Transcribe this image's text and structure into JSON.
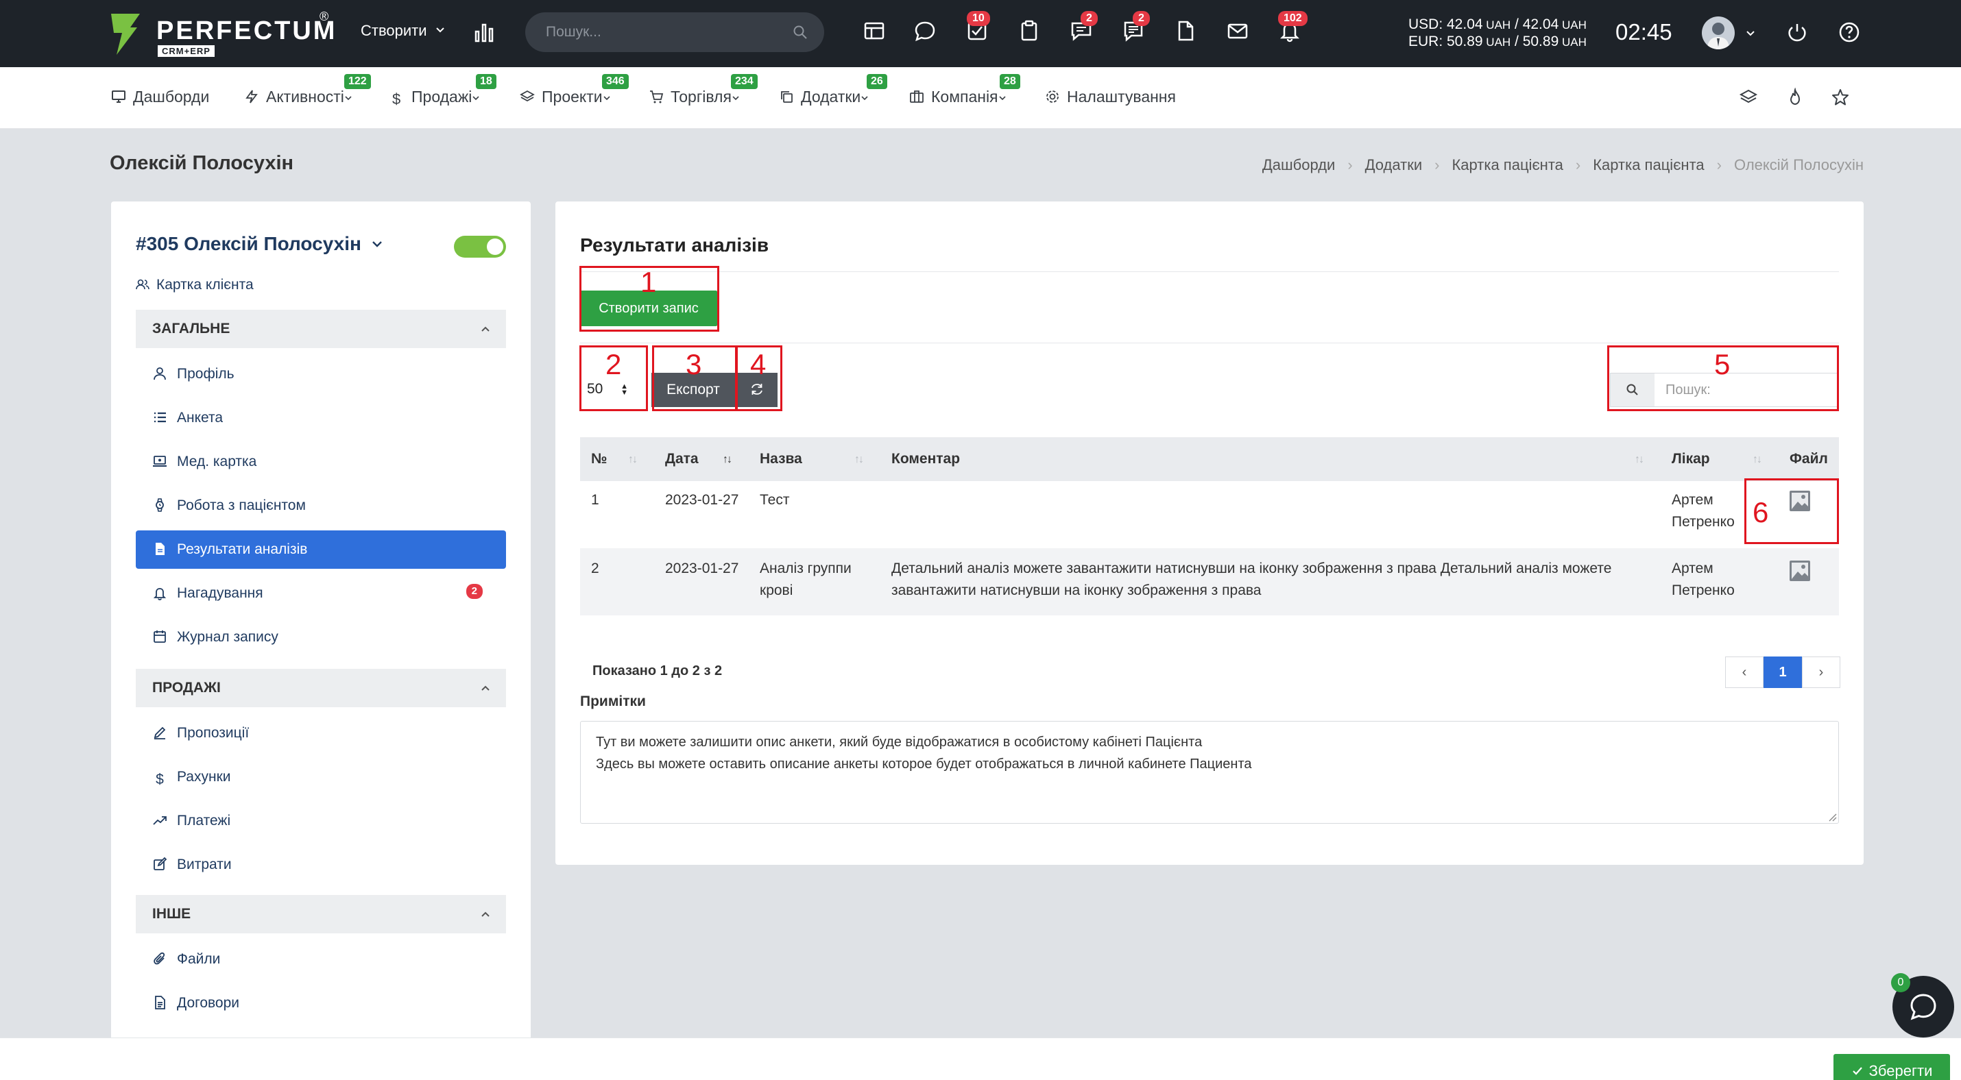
{
  "topbar": {
    "logo_text": "PERFECTUM",
    "logo_sub": "CRM+ERP",
    "logo_reg": "®",
    "create_label": "Створити",
    "search_placeholder": "Пошук...",
    "badges": {
      "tasks": "10",
      "chat": "2",
      "messages": "2",
      "notifications": "102"
    },
    "currency_usd": "USD: 42.04",
    "currency_usd_tail": " / 42.04",
    "currency_eur": "EUR: 50.89",
    "currency_eur_tail": " / 50.89",
    "currency_unit": " UAH",
    "time": "02:45"
  },
  "nav": {
    "items": [
      {
        "label": "Дашборди",
        "badge": ""
      },
      {
        "label": "Активності",
        "badge": "122"
      },
      {
        "label": "Продажі",
        "badge": "18"
      },
      {
        "label": "Проекти",
        "badge": "346"
      },
      {
        "label": "Торгівля",
        "badge": "234"
      },
      {
        "label": "Додатки",
        "badge": "26"
      },
      {
        "label": "Компанія",
        "badge": "28"
      },
      {
        "label": "Налаштування",
        "badge": ""
      }
    ]
  },
  "page": {
    "title": "Олексій Полосухін",
    "breadcrumb": [
      "Дашборди",
      "Додатки",
      "Картка пацієнта",
      "Картка пацієнта",
      "Олексій Полосухін"
    ]
  },
  "sidebar": {
    "patient": "#305 Олексій Полосухін",
    "client_card": "Картка клієнта",
    "sections": [
      {
        "title": "ЗАГАЛЬНЕ"
      },
      {
        "title": "ПРОДАЖІ"
      },
      {
        "title": "ІНШЕ"
      }
    ],
    "general_items": [
      {
        "label": "Профіль"
      },
      {
        "label": "Анкета"
      },
      {
        "label": "Мед. картка"
      },
      {
        "label": "Робота з пацієнтом"
      },
      {
        "label": "Результати аналізів"
      },
      {
        "label": "Нагадування",
        "badge": "2"
      },
      {
        "label": "Журнал запису"
      }
    ],
    "sales_items": [
      {
        "label": "Пропозиції"
      },
      {
        "label": "Рахунки"
      },
      {
        "label": "Платежі"
      },
      {
        "label": "Витрати"
      }
    ],
    "other_items": [
      {
        "label": "Файли"
      },
      {
        "label": "Договори"
      }
    ]
  },
  "main": {
    "title": "Результати аналізів",
    "create_button": "Створити запис",
    "per_page": "50",
    "export_button": "Експорт",
    "search_placeholder": "Пошук:",
    "columns": [
      "№",
      "Дата",
      "Назва",
      "Коментар",
      "Лікар",
      "Файл"
    ],
    "rows": [
      {
        "num": "1",
        "date": "2023-01-27",
        "name": "Тест",
        "comment": "",
        "doctor": "Артем Петренко"
      },
      {
        "num": "2",
        "date": "2023-01-27",
        "name": "Аналіз группи крові",
        "comment": "Детальний аналіз можете завантажити натиснувши на іконку зображення з права Детальний аналіз можете завантажити натиснувши на іконку зображення з права",
        "doctor": "Артем Петренко"
      }
    ],
    "shown_text": "Показано 1 до 2 з 2",
    "current_page": "1",
    "notes_label": "Примітки",
    "notes_line1": "Тут ви можете залишити опис анкети, який буде відображатися в особистому кабінеті Пацієнта",
    "notes_line2": "Здесь вы можете оставить описание анкеты которое будет отображаться в личной кабинете Пациента"
  },
  "annotations": [
    "1",
    "2",
    "3",
    "4",
    "5",
    "6"
  ],
  "footer": {
    "save_button": "Зберегти",
    "chat_badge": "0"
  },
  "colors": {
    "accent": "#2f6fdb",
    "success": "#2ea043",
    "danger": "#e53945",
    "annotation": "#e0151f",
    "topbar": "#1e2329"
  }
}
